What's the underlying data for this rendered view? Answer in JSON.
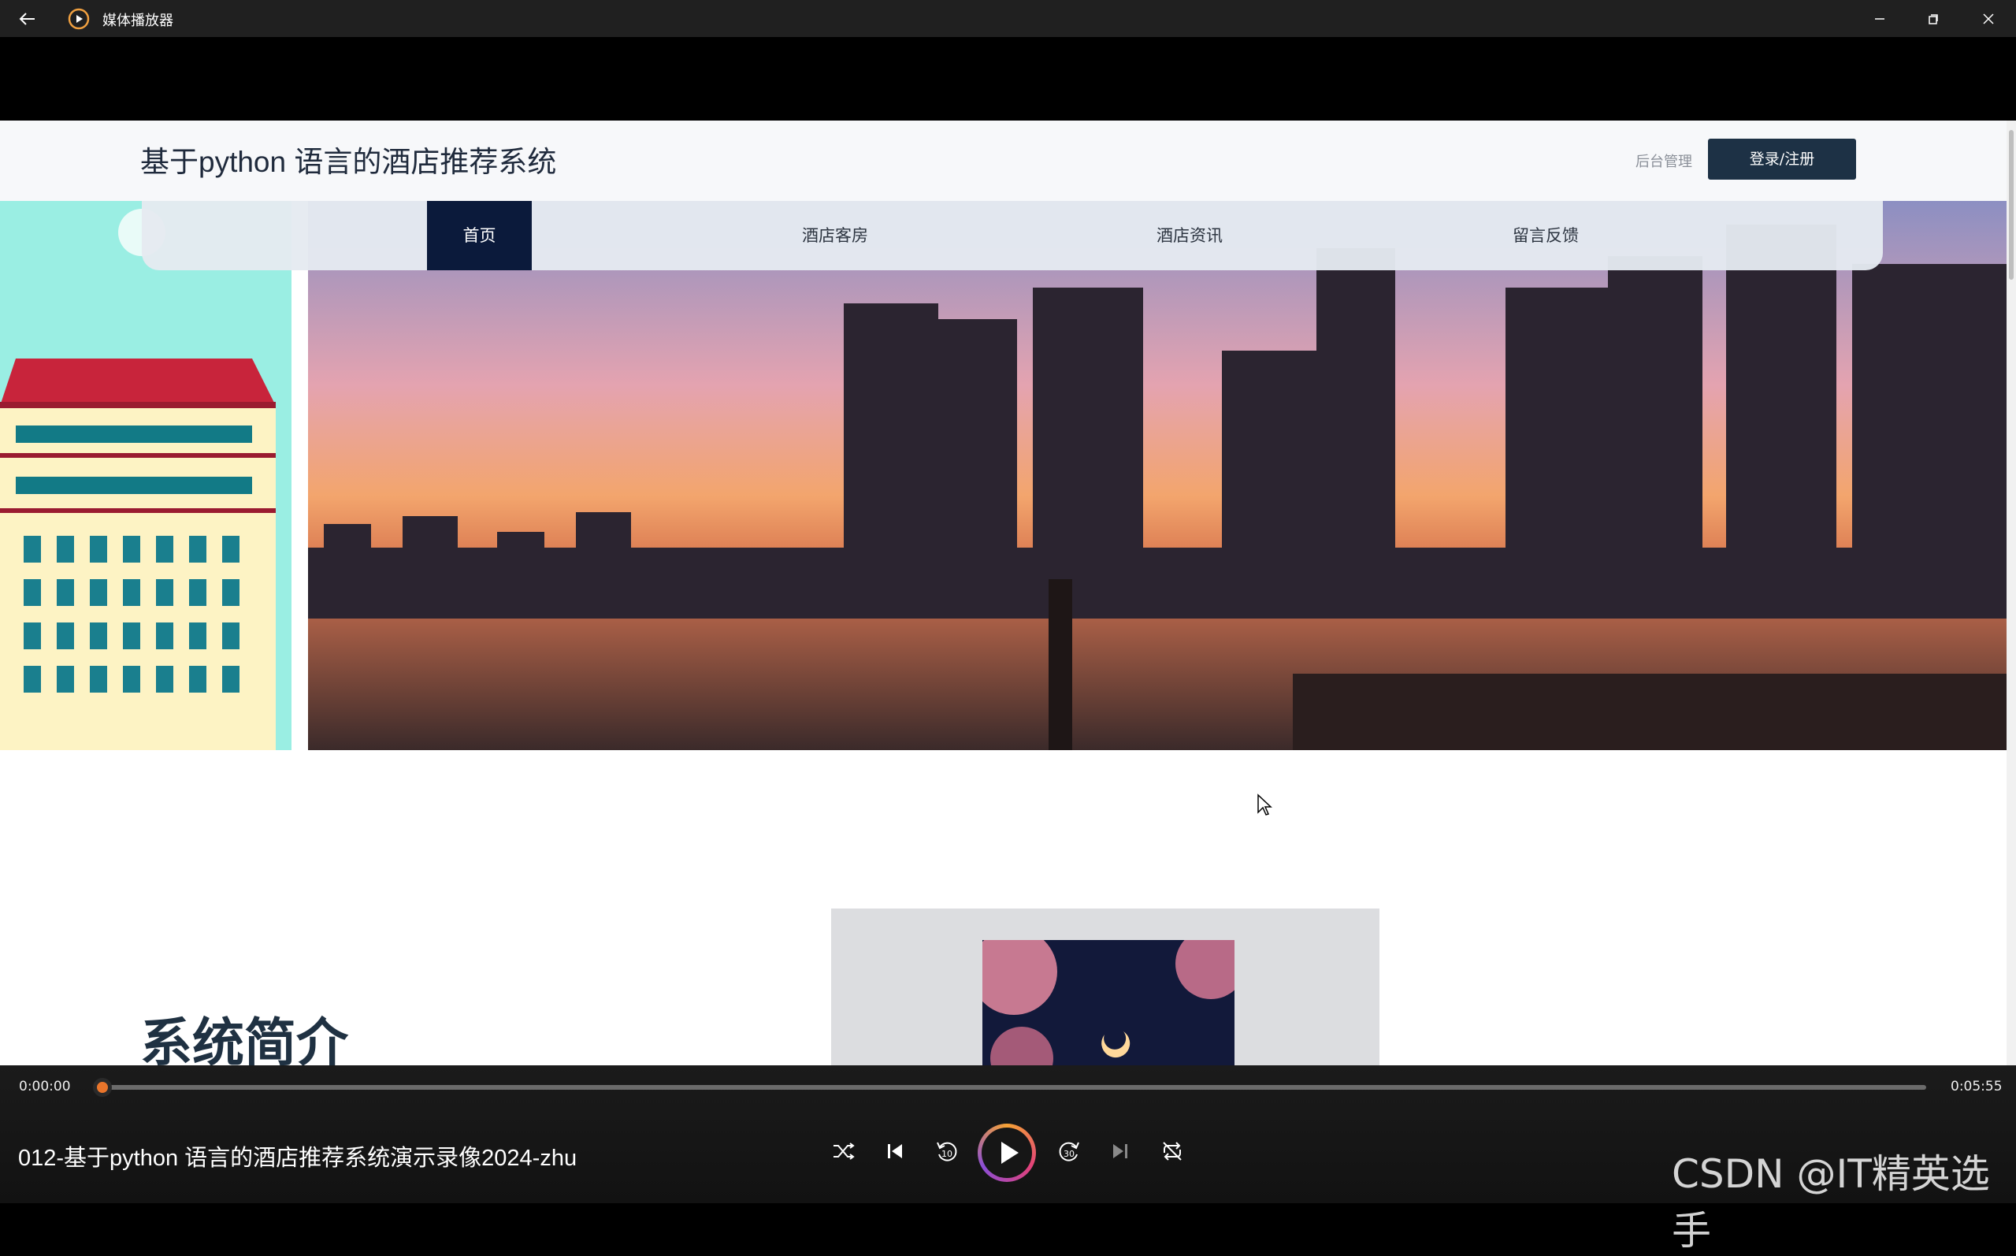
{
  "window": {
    "title": "媒体播放器",
    "icons": [
      "back-arrow-icon",
      "media-player-icon",
      "minimize-icon",
      "restore-icon",
      "close-icon"
    ]
  },
  "site": {
    "title": "基于python 语言的酒店推荐系统",
    "admin_label": "后台管理",
    "login_label": "登录/注册",
    "nav": [
      {
        "label": "首页",
        "active": true
      },
      {
        "label": "酒店客房",
        "active": false
      },
      {
        "label": "酒店资讯",
        "active": false
      },
      {
        "label": "留言反馈",
        "active": false
      }
    ],
    "intro_title": "系统简介"
  },
  "player": {
    "time_current": "0:00:00",
    "time_total": "0:05:55",
    "progress": 0.0,
    "video_title": "012-基于python 语言的酒店推荐系统演示录像2024-zhu",
    "controls": [
      "shuffle-icon",
      "previous-track-icon",
      "rewind-10-icon",
      "play-icon",
      "forward-30-icon",
      "next-track-icon",
      "repeat-off-icon"
    ],
    "watermark": "CSDN @IT精英选手"
  },
  "colors": {
    "titlebar": "#202020",
    "nav_active": "#0b1a3b",
    "login_button": "#1d3145",
    "seek_thumb": "#e9752b"
  }
}
